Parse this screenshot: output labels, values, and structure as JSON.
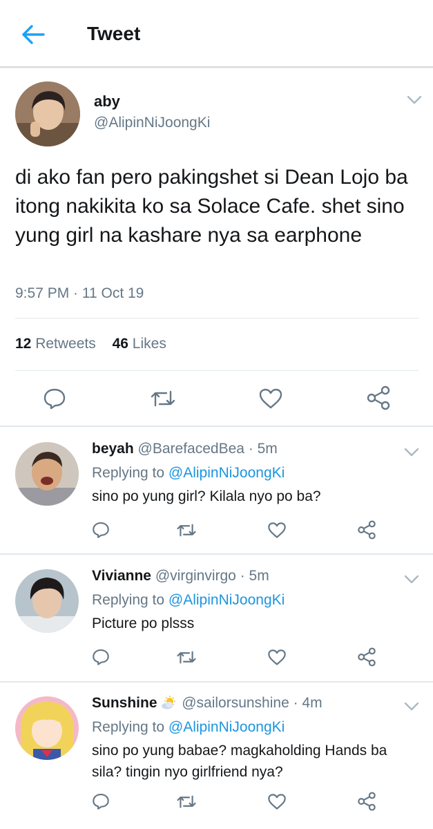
{
  "header": {
    "title": "Tweet",
    "back_icon": "arrow-left-icon",
    "accent": "#1da1f2"
  },
  "tweet": {
    "author_name": "aby",
    "author_handle": "@AlipinNiJoongKi",
    "text": "di ako fan pero pakingshet si Dean Lojo ba itong nakikita ko sa Solace Cafe. shet sino yung girl na kashare nya sa earphone",
    "timestamp": "9:57 PM · 11 Oct 19",
    "retweets_count": "12",
    "retweets_label": "Retweets",
    "likes_count": "46",
    "likes_label": "Likes"
  },
  "replies": [
    {
      "name": "beyah",
      "handle_time": "@BarefacedBea · 5m",
      "replying_label": "Replying to",
      "replying_handle": "@AlipinNiJoongKi",
      "text": "sino po yung girl? Kilala nyo po ba?"
    },
    {
      "name": "Vivianne",
      "handle_time": "@virginvirgo · 5m",
      "replying_label": "Replying to",
      "replying_handle": "@AlipinNiJoongKi",
      "text": "Picture po plsss"
    },
    {
      "name": "Sunshine",
      "name_emoji": "sun-behind-cloud-icon",
      "handle_time": "@sailorsunshine · 4m",
      "replying_label": "Replying to",
      "replying_handle": "@AlipinNiJoongKi",
      "text": "sino po yung babae? magkaholding Hands ba sila? tingin nyo girlfriend nya?"
    }
  ],
  "colors": {
    "link": "#1b95e0",
    "secondary_text": "#657786",
    "divider": "#e1e8ed"
  }
}
